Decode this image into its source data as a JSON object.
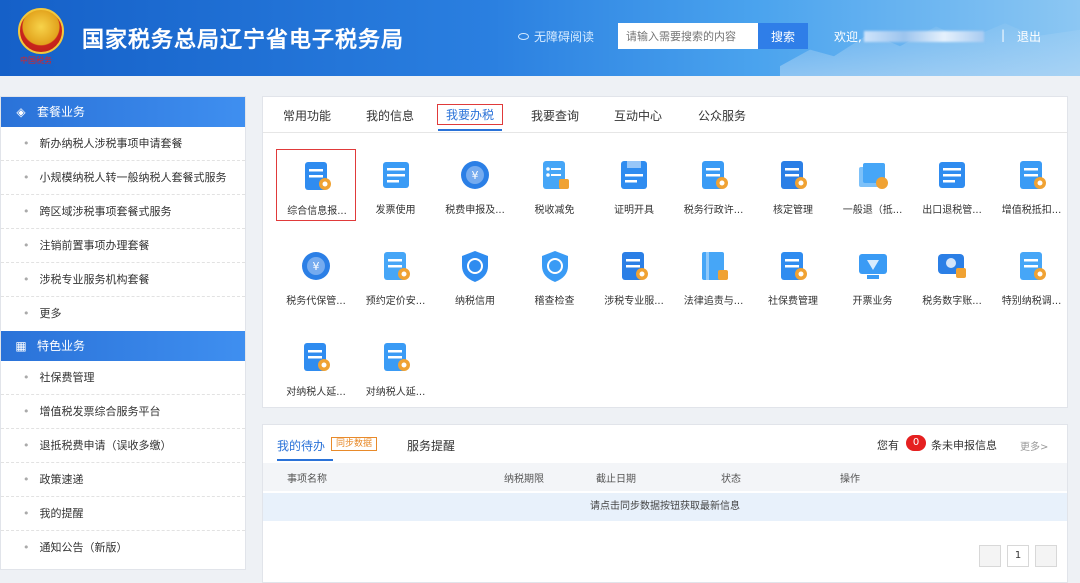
{
  "header": {
    "emblem_text": "中国税务",
    "title": "国家税务总局辽宁省电子税务局",
    "accessibility": "无障碍阅读",
    "search_placeholder": "请输入需要搜索的内容",
    "search_button": "搜索",
    "welcome": "欢迎,",
    "separator": "|",
    "logout": "退出"
  },
  "sidebar": {
    "sections": [
      {
        "title": "套餐业务",
        "icon": "layers-icon",
        "items": [
          "新办纳税人涉税事项申请套餐",
          "小规模纳税人转一般纳税人套餐式服务",
          "跨区域涉税事项套餐式服务",
          "注销前置事项办理套餐",
          "涉税专业服务机构套餐",
          "更多"
        ]
      },
      {
        "title": "特色业务",
        "icon": "grid-icon",
        "items": [
          "社保费管理",
          "增值税发票综合服务平台",
          "退抵税费申请（误收多缴）",
          "政策速递",
          "我的提醒",
          "通知公告（新版）"
        ]
      }
    ]
  },
  "tabs": [
    "常用功能",
    "我的信息",
    "我要办税",
    "我要查询",
    "互动中心",
    "公众服务"
  ],
  "active_tab": "我要办税",
  "functions": [
    {
      "label": "综合信息报...",
      "icon": "report-icon",
      "highlighted": true
    },
    {
      "label": "发票使用",
      "icon": "invoice-icon"
    },
    {
      "label": "税费申报及...",
      "icon": "tax-declare-icon"
    },
    {
      "label": "税收减免",
      "icon": "tax-relief-icon"
    },
    {
      "label": "证明开具",
      "icon": "certificate-icon"
    },
    {
      "label": "税务行政许...",
      "icon": "license-icon"
    },
    {
      "label": "核定管理",
      "icon": "verify-icon"
    },
    {
      "label": "一般退（抵...",
      "icon": "refund-icon"
    },
    {
      "label": "出口退税管...",
      "icon": "export-refund-icon"
    },
    {
      "label": "增值税抵扣...",
      "icon": "vat-deduct-icon"
    },
    {
      "label": "税务代保管...",
      "icon": "custody-icon"
    },
    {
      "label": "预约定价安...",
      "icon": "pricing-icon"
    },
    {
      "label": "纳税信用",
      "icon": "credit-icon"
    },
    {
      "label": "稽查检查",
      "icon": "inspect-icon"
    },
    {
      "label": "涉税专业服...",
      "icon": "professional-icon"
    },
    {
      "label": "法律追责与...",
      "icon": "legal-icon"
    },
    {
      "label": "社保费管理",
      "icon": "social-security-icon"
    },
    {
      "label": "开票业务",
      "icon": "issue-invoice-icon"
    },
    {
      "label": "税务数字账...",
      "icon": "digital-account-icon"
    },
    {
      "label": "特别纳税调...",
      "icon": "special-tax-icon"
    },
    {
      "label": "对纳税人延...",
      "icon": "extension-icon"
    },
    {
      "label": "对纳税人延...",
      "icon": "extension-alt-icon"
    }
  ],
  "todo": {
    "tabs": [
      "我的待办",
      "服务提醒"
    ],
    "sync_label": "同步数据",
    "count_prefix": "您有",
    "count": "0",
    "count_suffix": "条未申报信息",
    "more": "更多>",
    "columns": [
      "事项名称",
      "纳税期限",
      "截止日期",
      "状态",
      "操作"
    ],
    "empty_message": "请点击同步数据按钮获取最新信息",
    "page": "1"
  }
}
